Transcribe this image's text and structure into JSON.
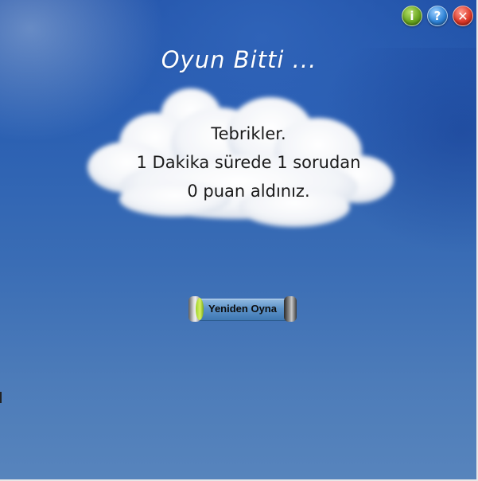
{
  "header": {
    "title": "Oyun Bitti ..."
  },
  "toolbar": {
    "info": {
      "icon": "info-icon",
      "glyph": "i",
      "color": "#6aa620"
    },
    "help": {
      "icon": "help-icon",
      "glyph": "?",
      "color": "#2f84d8"
    },
    "close": {
      "icon": "close-icon",
      "glyph": "✕",
      "color": "#de3a2a"
    }
  },
  "result": {
    "line1": "Tebrikler.",
    "line2": "1 Dakika sürede 1 sorudan",
    "line3": "0 puan aldınız."
  },
  "replay_button": {
    "label": "Yeniden Oyna"
  },
  "colors": {
    "sky": "#2a5fb2",
    "title_text": "#ffffff",
    "result_text": "#1a1a1a"
  }
}
